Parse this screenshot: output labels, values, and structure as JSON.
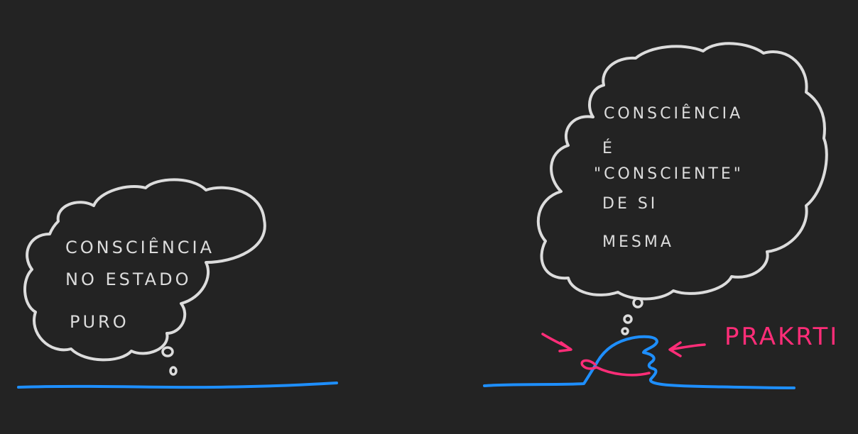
{
  "colors": {
    "background": "#232323",
    "chalk": "#dcdcdc",
    "water": "#1e8fff",
    "accent": "#ff2d78"
  },
  "left_bubble": {
    "lines": [
      "CONSCIÊNCIA",
      "NO ESTADO",
      "PURO"
    ]
  },
  "right_bubble": {
    "lines": [
      "CONSCIÊNCIA",
      "É",
      "\"CONSCIENTE\"",
      "DE SI",
      "MESMA"
    ]
  },
  "wave_label": "PRAKRTI",
  "icons": [
    "thought-bubble",
    "water-line",
    "wave",
    "arrow"
  ]
}
